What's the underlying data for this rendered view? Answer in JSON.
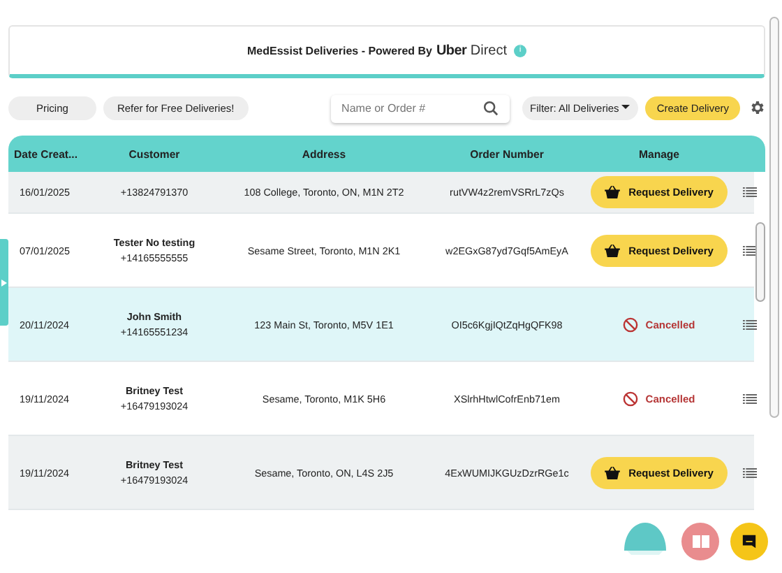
{
  "header": {
    "title": "MedEssist Deliveries - Powered By",
    "brand_bold": "Uber",
    "brand_light": "Direct",
    "info_badge": "i"
  },
  "toolbar": {
    "buttons": [
      "Pricing",
      "Refer for Free Deliveries!"
    ],
    "search": {
      "placeholder": "Name or Order #"
    },
    "filter": "Filter: All Deliveries",
    "create": "Create Delivery"
  },
  "table": {
    "columns": [
      "Date Creat...",
      "Customer",
      "Address",
      "Order Number",
      "Manage"
    ],
    "rows": [
      {
        "date": "16/01/2025",
        "phone": "+13824791370",
        "address": "108 College, Toronto, ON, M1N 2T2",
        "order": "rutVW4z2remVSRrL7zQs",
        "status": {
          "kind": "request",
          "label": "Request Delivery"
        },
        "highlighted": false
      },
      {
        "date": "07/01/2025",
        "name": "Tester No testing",
        "phone": "+14165555555",
        "address": "Sesame Street, Toronto, M1N 2K1",
        "order": "w2EGxG87yd7Gqf5AmEyA",
        "status": {
          "kind": "request",
          "label": "Request Delivery"
        },
        "highlighted": false
      },
      {
        "date": "20/11/2024",
        "name": "John Smith",
        "phone": "+14165551234",
        "address": "123 Main St, Toronto, M5V 1E1",
        "order": "OI5c6KgjIQtZqHgQFK98",
        "status": {
          "kind": "cancelled",
          "label": "Cancelled"
        },
        "highlighted": true
      },
      {
        "date": "19/11/2024",
        "name": "Britney Test",
        "phone": "+16479193024",
        "address": "Sesame, Toronto, M1K 5H6",
        "order": "XSlrhHtwlCofrEnb71em",
        "status": {
          "kind": "cancelled",
          "label": "Cancelled"
        },
        "highlighted": false
      },
      {
        "date": "19/11/2024",
        "name": "Britney Test",
        "phone": "+16479193024",
        "address": "Sesame, Toronto, ON, L4S 2J5",
        "order": "4ExWUMIJKGUzDzrRGe1c",
        "status": {
          "kind": "request",
          "label": "Request Delivery"
        },
        "highlighted": false
      }
    ]
  }
}
